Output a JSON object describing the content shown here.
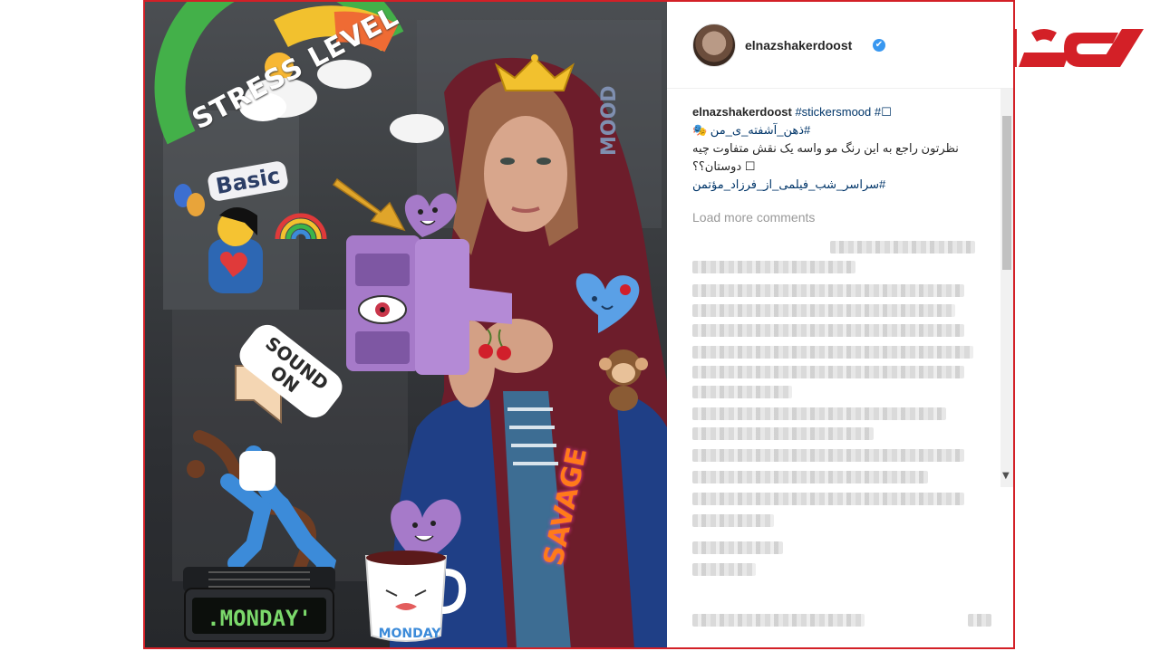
{
  "post": {
    "username": "elnazshakerdoost",
    "verified_mark": "✔",
    "caption": {
      "user": "elnazshakerdoost",
      "line1": "#stickersmood #☐",
      "line2": "#ذهن_آشفته_ی_من 🎭",
      "line3": "نظرتون راجع به این رنگ مو واسه یک نقش متفاوت چیه",
      "line4": "☐ دوستان؟؟",
      "line5": "#سراسر_شب_فیلمی_از_فرزاد_مؤتمن"
    },
    "load_more": "Load more comments"
  },
  "stickers": {
    "stress_level": "STRESS LEVEL",
    "basic": "Basic",
    "sound_on": "SOUND ON",
    "mood": "MOOD",
    "savage": "SAVAGE",
    "monday_clock": ".MONDAY'",
    "monday_mug": "MONDAY"
  },
  "colors": {
    "frame": "#d32027",
    "logo": "#d32027",
    "verified": "#3897f0",
    "link": "#003569"
  },
  "icons": [
    "sun-cloud-icon",
    "crown-icon",
    "trumpet-icon",
    "heart-icon",
    "eye-icon",
    "cherry-icon",
    "monkey-icon",
    "rainbow-icon",
    "theater-masks-icon",
    "speaker-icon"
  ]
}
